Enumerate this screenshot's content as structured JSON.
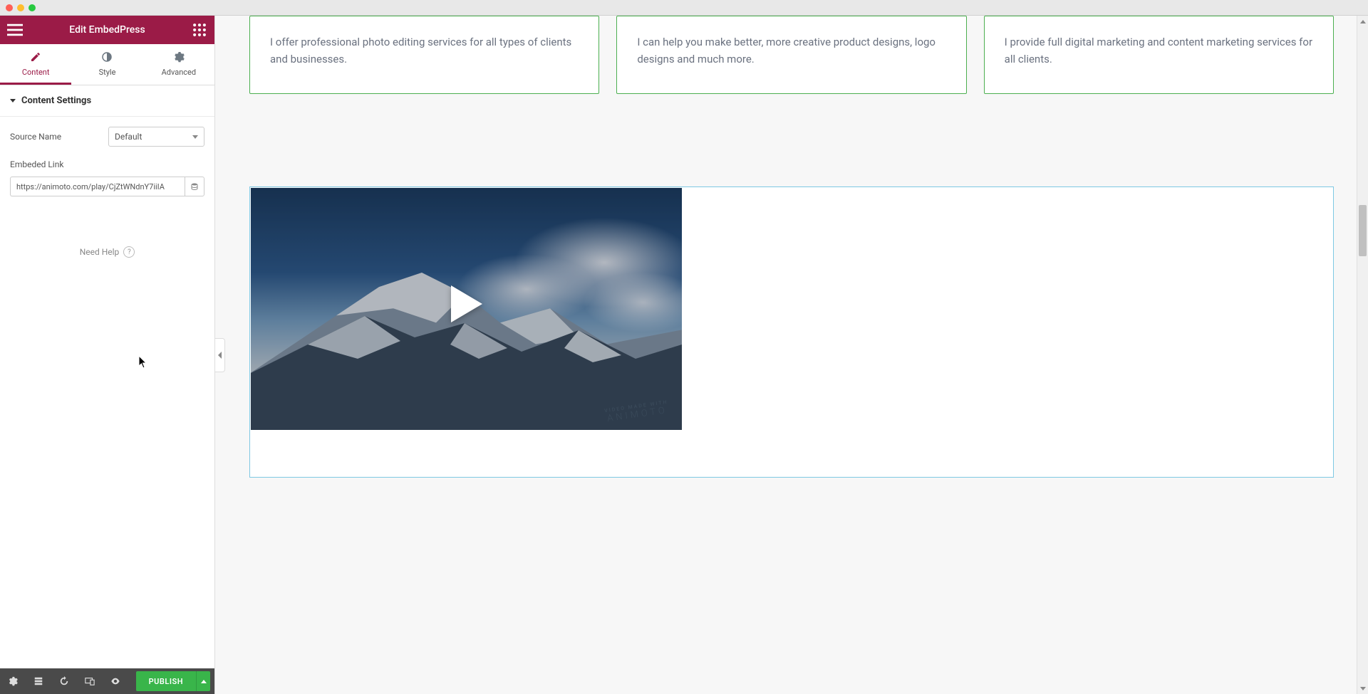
{
  "header": {
    "title": "Edit EmbedPress"
  },
  "tabs": {
    "content": "Content",
    "style": "Style",
    "advanced": "Advanced"
  },
  "section": {
    "title": "Content Settings",
    "source_name_label": "Source Name",
    "source_name_value": "Default",
    "embedded_link_label": "Embeded Link",
    "embedded_link_value": "https://animoto.com/play/CjZtWNdnY7iiIA"
  },
  "need_help": "Need Help",
  "publish": "PUBLISH",
  "cards": [
    {
      "text": "I offer professional photo editing services for all types of clients and businesses."
    },
    {
      "text": "I can help you make better, more creative product designs, logo designs and much more."
    },
    {
      "text": "I provide full digital marketing and content marketing services for all clients."
    }
  ],
  "watermark": {
    "line1": "VIDEO MADE WITH",
    "line2": "ANIMOTO"
  }
}
